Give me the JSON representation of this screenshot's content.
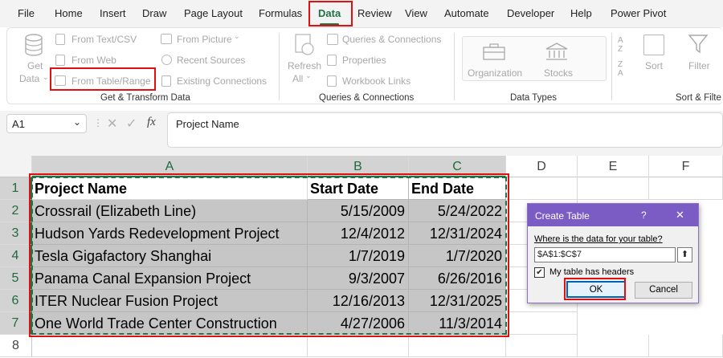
{
  "tabs": [
    "File",
    "Home",
    "Insert",
    "Draw",
    "Page Layout",
    "Formulas",
    "Data",
    "Review",
    "View",
    "Automate",
    "Developer",
    "Help",
    "Power Pivot"
  ],
  "ribbon": {
    "get_data": "Get",
    "get_data2": "Data",
    "from_text_csv": "From Text/CSV",
    "from_web": "From Web",
    "from_table_range": "From Table/Range",
    "from_picture": "From Picture",
    "recent_sources": "Recent Sources",
    "existing_connections": "Existing Connections",
    "group_get_transform": "Get & Transform Data",
    "refresh": "Refresh",
    "refresh_all": "All",
    "queries_connections": "Queries & Connections",
    "properties": "Properties",
    "workbook_links": "Workbook Links",
    "group_queries": "Queries & Connections",
    "organization": "Organization",
    "stocks": "Stocks",
    "group_data_types": "Data Types",
    "sort": "Sort",
    "filter": "Filter",
    "group_sort_filter": "Sort & Filte"
  },
  "formula_bar": {
    "name_box": "A1",
    "fx": "fx",
    "content": "Project Name"
  },
  "columns": [
    "A",
    "B",
    "C",
    "D",
    "E",
    "F"
  ],
  "rows": [
    "1",
    "2",
    "3",
    "4",
    "5",
    "6",
    "7",
    "8"
  ],
  "table": {
    "headers": [
      "Project Name",
      "Start Date",
      "End Date"
    ],
    "data": [
      [
        "Crossrail (Elizabeth Line)",
        "5/15/2009",
        "5/24/2022"
      ],
      [
        "Hudson Yards Redevelopment Project",
        "12/4/2012",
        "12/31/2024"
      ],
      [
        "Tesla Gigafactory Shanghai",
        "1/7/2019",
        "1/7/2020"
      ],
      [
        "Panama Canal Expansion Project",
        "9/3/2007",
        "6/26/2016"
      ],
      [
        "ITER Nuclear Fusion Project",
        "12/16/2013",
        "12/31/2025"
      ],
      [
        "One World Trade Center Construction",
        "4/27/2006",
        "11/3/2014"
      ]
    ]
  },
  "dialog": {
    "title": "Create Table",
    "help": "?",
    "close": "✕",
    "prompt": "Where is the data for your table?",
    "range": "$A$1:$C$7",
    "headers_label": "My table has headers",
    "checked": "✔",
    "ok": "OK",
    "cancel": "Cancel"
  },
  "colors": {
    "accent": "#1f7244",
    "dialog_title": "#7b5cc4",
    "highlight": "#e01010"
  }
}
